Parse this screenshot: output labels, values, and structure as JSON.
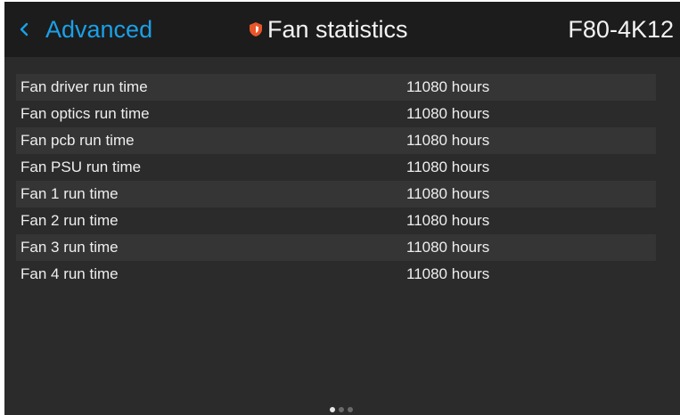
{
  "header": {
    "back_label": "Advanced",
    "title": "Fan statistics",
    "model": "F80-4K12",
    "icons": {
      "back": "chevron-left-icon",
      "title": "shield-icon"
    },
    "colors": {
      "accent": "#1aa0e8",
      "shield": "#e8562a"
    }
  },
  "rows": [
    {
      "name": "Fan driver run time",
      "value": "11080 hours"
    },
    {
      "name": "Fan optics run time",
      "value": "11080 hours"
    },
    {
      "name": "Fan pcb run time",
      "value": "11080 hours"
    },
    {
      "name": "Fan PSU run time",
      "value": "11080 hours"
    },
    {
      "name": "Fan 1 run time",
      "value": "11080 hours"
    },
    {
      "name": "Fan 2 run time",
      "value": "11080 hours"
    },
    {
      "name": "Fan 3 run time",
      "value": "11080 hours"
    },
    {
      "name": "Fan 4 run time",
      "value": "11080 hours"
    }
  ],
  "pagination": {
    "pages": 3,
    "current": 1
  }
}
